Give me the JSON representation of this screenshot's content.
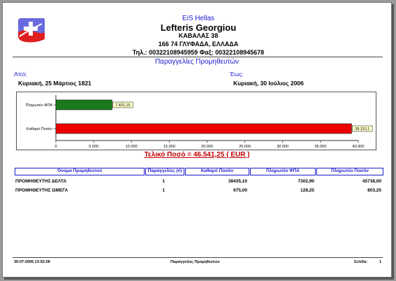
{
  "header": {
    "company": "EiS Hellas",
    "person": "Lefteris Georgiou",
    "address_line1": "ΚΑΒΑΛΑΣ 38",
    "address_line2": "166 74 ΓΛΥΦΑΔΑ, ΕΛΛΑΔΑ",
    "phones": "Τηλ.: 00322108945959 Φαξ: 00322108945678"
  },
  "report_title": "Παραγγελίες Προμηθευτών",
  "from": {
    "label": "Από:",
    "value": "Κυριακή, 25 Μάρτιος 1821"
  },
  "to": {
    "label": "Έως:",
    "value": "Κυριακή, 30 Ιούλιος 2006"
  },
  "chart_data": {
    "type": "bar",
    "orientation": "horizontal",
    "categories": [
      "Πληρωτέο ΦΠΑ",
      "Καθαρό Ποσόν"
    ],
    "values": [
      7431.15,
      39110.1
    ],
    "value_labels": [
      "7.431,15",
      "39.110,1"
    ],
    "bar_colors": [
      "#1a7a1a",
      "#ee0000"
    ],
    "xlim": [
      0,
      40000
    ],
    "xticks": [
      "0",
      "5.000",
      "10.000",
      "15.000",
      "20.000",
      "25.000",
      "30.000",
      "35.000",
      "40.000"
    ],
    "grid": false
  },
  "total": "Τελικό Ποσό = 46.541,25 ( EUR )",
  "table": {
    "columns": [
      "Όνομα Προμηθευτού",
      "Παραγγελίες (#)",
      "Καθαρό Ποσόν",
      "Πληρωτέο ΦΠΑ",
      "Πληρωτέο Ποσόν"
    ],
    "rows": [
      [
        "ΠΡΟΜΗΘΕΥΤΗΣ ΔΕΛΤΑ",
        "1",
        "38435,10",
        "7302,90",
        "45738,00"
      ],
      [
        "ΠΡΟΜΗΘΕΥΤΗΣ ΩΜΕΓΑ",
        "1",
        "675,00",
        "128,25",
        "803,25"
      ]
    ]
  },
  "footer": {
    "timestamp": "30-07-2006 13:52:28",
    "report_name": "Παραγγελίες Προμηθευτών",
    "page_label": "Σελίδα:",
    "page_number": "1"
  }
}
